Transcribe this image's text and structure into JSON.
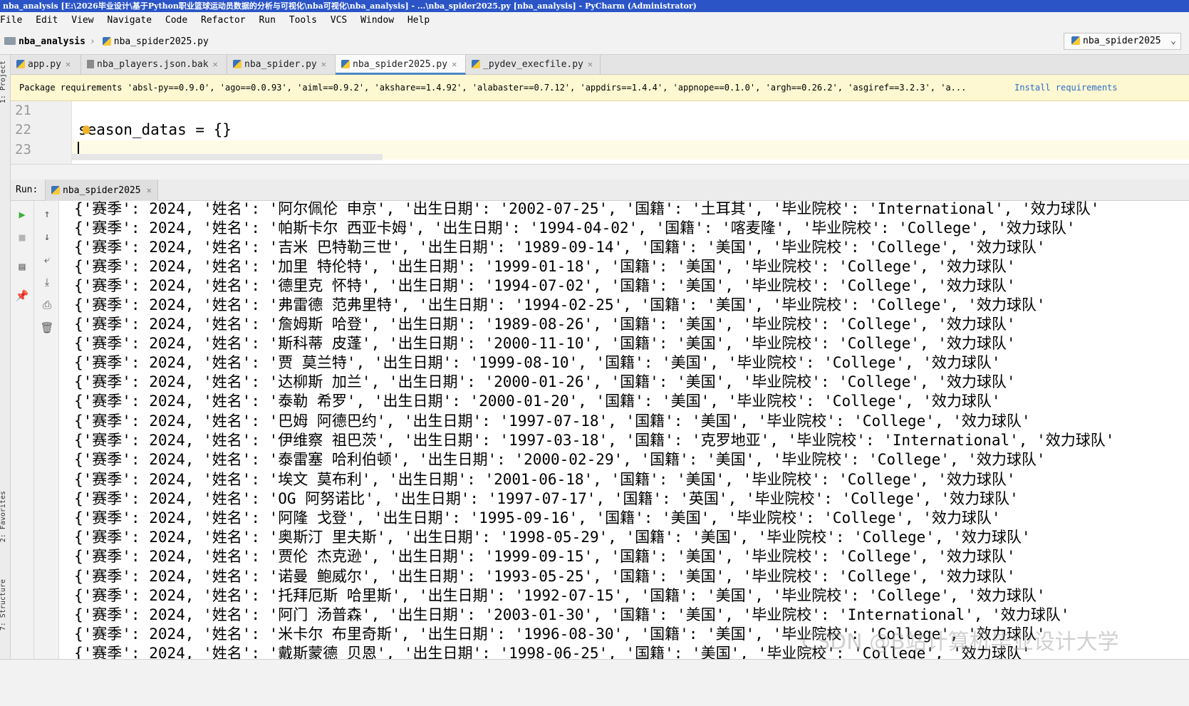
{
  "window": {
    "title": "nba_analysis [E:\\2026毕业设计\\基于Python职业篮球运动员数据的分析与可视化\\nba可视化\\nba_analysis] - ...\\nba_spider2025.py [nba_analysis] - PyCharm (Administrator)"
  },
  "menu": [
    "File",
    "Edit",
    "View",
    "Navigate",
    "Code",
    "Refactor",
    "Run",
    "Tools",
    "VCS",
    "Window",
    "Help"
  ],
  "breadcrumb": {
    "project": "nba_analysis",
    "file": "nba_spider2025.py"
  },
  "run_config": {
    "label": "nba_spider2025",
    "icon": "python-icon"
  },
  "side_tools": [
    "1: Project",
    "2: Favorites",
    "7: Structure"
  ],
  "tabs": [
    {
      "label": "app.py",
      "icon": "python-icon"
    },
    {
      "label": "nba_players.json.bak",
      "icon": "file-icon"
    },
    {
      "label": "nba_spider.py",
      "icon": "python-icon"
    },
    {
      "label": "nba_spider2025.py",
      "icon": "python-icon",
      "active": true
    },
    {
      "label": "_pydev_execfile.py",
      "icon": "python-icon"
    }
  ],
  "banner": {
    "text": "Package requirements 'absl-py==0.9.0', 'ago==0.0.93', 'aiml==0.9.2', 'akshare==1.4.92', 'alabaster==0.7.12', 'appdirs==1.4.4', 'appnope==0.1.0', 'argh==0.26.2', 'asgiref==3.2.3', 'a...",
    "link": "Install requirements"
  },
  "editor": {
    "lines": [
      {
        "no": "21",
        "code": ""
      },
      {
        "no": "22",
        "code": "season_datas = {}"
      },
      {
        "no": "23",
        "code": ""
      }
    ]
  },
  "run": {
    "label": "Run:",
    "tab": "nba_spider2025"
  },
  "console": [
    "{'赛季': 2024, '姓名': '阿尔佩伦 申京', '出生日期': '2002-07-25', '国籍': '土耳其', '毕业院校': 'International', '效力球队'",
    "{'赛季': 2024, '姓名': '帕斯卡尔 西亚卡姆', '出生日期': '1994-04-02', '国籍': '喀麦隆', '毕业院校': 'College', '效力球队'",
    "{'赛季': 2024, '姓名': '吉米 巴特勒三世', '出生日期': '1989-09-14', '国籍': '美国', '毕业院校': 'College', '效力球队'",
    "{'赛季': 2024, '姓名': '加里 特伦特', '出生日期': '1999-01-18', '国籍': '美国', '毕业院校': 'College', '效力球队'",
    "{'赛季': 2024, '姓名': '德里克 怀特', '出生日期': '1994-07-02', '国籍': '美国', '毕业院校': 'College', '效力球队'",
    "{'赛季': 2024, '姓名': '弗雷德 范弗里特', '出生日期': '1994-02-25', '国籍': '美国', '毕业院校': 'College', '效力球队'",
    "{'赛季': 2024, '姓名': '詹姆斯 哈登', '出生日期': '1989-08-26', '国籍': '美国', '毕业院校': 'College', '效力球队'",
    "{'赛季': 2024, '姓名': '斯科蒂 皮蓬', '出生日期': '2000-11-10', '国籍': '美国', '毕业院校': 'College', '效力球队'",
    "{'赛季': 2024, '姓名': '贾 莫兰特', '出生日期': '1999-08-10', '国籍': '美国', '毕业院校': 'College', '效力球队'",
    "{'赛季': 2024, '姓名': '达柳斯 加兰', '出生日期': '2000-01-26', '国籍': '美国', '毕业院校': 'College', '效力球队'",
    "{'赛季': 2024, '姓名': '泰勒 希罗', '出生日期': '2000-01-20', '国籍': '美国', '毕业院校': 'College', '效力球队'",
    "{'赛季': 2024, '姓名': '巴姆 阿德巴约', '出生日期': '1997-07-18', '国籍': '美国', '毕业院校': 'College', '效力球队'",
    "{'赛季': 2024, '姓名': '伊维察 祖巴茨', '出生日期': '1997-03-18', '国籍': '克罗地亚', '毕业院校': 'International', '效力球队'",
    "{'赛季': 2024, '姓名': '泰雷塞 哈利伯顿', '出生日期': '2000-02-29', '国籍': '美国', '毕业院校': 'College', '效力球队'",
    "{'赛季': 2024, '姓名': '埃文 莫布利', '出生日期': '2001-06-18', '国籍': '美国', '毕业院校': 'College', '效力球队'",
    "{'赛季': 2024, '姓名': 'OG 阿努诺比', '出生日期': '1997-07-17', '国籍': '英国', '毕业院校': 'College', '效力球队'",
    "{'赛季': 2024, '姓名': '阿隆 戈登', '出生日期': '1995-09-16', '国籍': '美国', '毕业院校': 'College', '效力球队'",
    "{'赛季': 2024, '姓名': '奥斯汀 里夫斯', '出生日期': '1998-05-29', '国籍': '美国', '毕业院校': 'College', '效力球队'",
    "{'赛季': 2024, '姓名': '贾伦 杰克逊', '出生日期': '1999-09-15', '国籍': '美国', '毕业院校': 'College', '效力球队'",
    "{'赛季': 2024, '姓名': '诺曼 鲍威尔', '出生日期': '1993-05-25', '国籍': '美国', '毕业院校': 'College', '效力球队'",
    "{'赛季': 2024, '姓名': '托拜厄斯 哈里斯', '出生日期': '1992-07-15', '国籍': '美国', '毕业院校': 'College', '效力球队'",
    "{'赛季': 2024, '姓名': '阿门 汤普森', '出生日期': '2003-01-30', '国籍': '美国', '毕业院校': 'International', '效力球队'",
    "{'赛季': 2024, '姓名': '米卡尔 布里奇斯', '出生日期': '1996-08-30', '国籍': '美国', '毕业院校': 'College', '效力球队'",
    "{'赛季': 2024, '姓名': '戴斯蒙德 贝恩', '出生日期': '1998-06-25', '国籍': '美国', '毕业院校': 'College', '效力球队'"
  ],
  "watermark": "CSDN @B站计算机毕业设计大学"
}
